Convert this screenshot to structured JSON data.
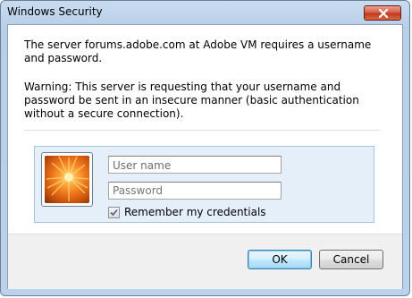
{
  "window": {
    "title": "Windows Security"
  },
  "message": {
    "line1": "The server forums.adobe.com at Adobe VM requires a username and password.",
    "warning": "Warning: This server is requesting that your username and password be sent in an insecure manner (basic authentication without a secure connection)."
  },
  "credentials": {
    "username_placeholder": "User name",
    "password_placeholder": "Password",
    "remember_label": "Remember my credentials",
    "remember_checked": true
  },
  "buttons": {
    "ok": "OK",
    "cancel": "Cancel"
  },
  "icons": {
    "close": "close-icon",
    "avatar": "user-tile-flower",
    "check": "checkmark-icon"
  },
  "colors": {
    "titlebar": "#c9dcf0",
    "close_button": "#d7604a",
    "panel": "#e4effa",
    "ok_border": "#3c7fb1"
  }
}
